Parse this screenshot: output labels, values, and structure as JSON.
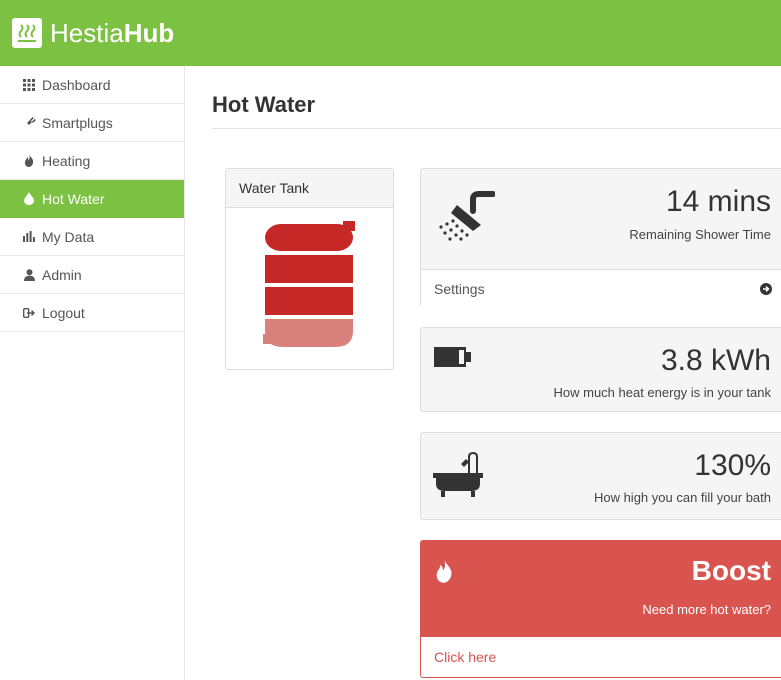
{
  "brand": {
    "name_light": "Hestia",
    "name_bold": "Hub",
    "logo_icon": "heat-waves-icon"
  },
  "colors": {
    "brand_green": "#7cc142",
    "danger_red": "#d9534f",
    "tank_full": "#c62828",
    "tank_low": "#d9817c"
  },
  "sidebar": {
    "items": [
      {
        "label": "Dashboard",
        "icon": "grid-icon",
        "active": false
      },
      {
        "label": "Smartplugs",
        "icon": "plug-icon",
        "active": false
      },
      {
        "label": "Heating",
        "icon": "flame-icon",
        "active": false
      },
      {
        "label": "Hot Water",
        "icon": "drop-icon",
        "active": true
      },
      {
        "label": "My Data",
        "icon": "bar-chart-icon",
        "active": false
      },
      {
        "label": "Admin",
        "icon": "user-icon",
        "active": false
      },
      {
        "label": "Logout",
        "icon": "logout-icon",
        "active": false
      }
    ]
  },
  "main": {
    "title": "Hot Water",
    "tank": {
      "heading": "Water Tank",
      "filled_segments": 3,
      "total_segments": 4
    },
    "shower": {
      "value": "14 mins",
      "label": "Remaining Shower Time",
      "footer": "Settings",
      "icon": "shower-icon"
    },
    "energy": {
      "value": "3.8 kWh",
      "label": "How much heat energy is in your tank",
      "icon": "battery-icon"
    },
    "bath": {
      "value": "130%",
      "label": "How high you can fill your bath",
      "icon": "bathtub-icon"
    },
    "boost": {
      "title": "Boost",
      "label": "Need more hot water?",
      "link": "Click here",
      "icon": "flame-icon"
    }
  }
}
